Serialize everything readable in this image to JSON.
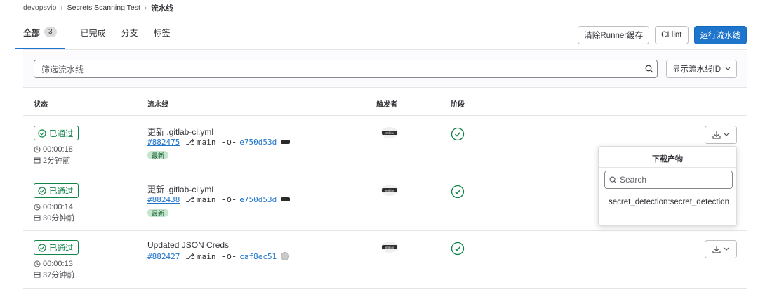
{
  "breadcrumb": {
    "group": "devopsvip",
    "project": "Secrets Scanning Test",
    "current": "流水线"
  },
  "tabs": [
    {
      "label": "全部",
      "count": "3",
      "active": true
    },
    {
      "label": "已完成"
    },
    {
      "label": "分支"
    },
    {
      "label": "标签"
    }
  ],
  "actions": {
    "clear_cache": "清除Runner缓存",
    "ci_lint": "CI lint",
    "run_pipeline": "运行流水线"
  },
  "filter": {
    "placeholder": "筛选流水线",
    "sort_label": "显示流水线ID"
  },
  "columns": {
    "status": "状态",
    "pipeline": "流水线",
    "triggerer": "触发者",
    "stages": "阶段"
  },
  "rows": [
    {
      "status": "已通过",
      "duration": "00:00:18",
      "finished": "2分钟前",
      "title": "更新 .gitlab-ci.yml",
      "id": "#882475",
      "branch": "main",
      "sha": "e750d53d",
      "latest": "最新"
    },
    {
      "status": "已通过",
      "duration": "00:00:14",
      "finished": "30分钟前",
      "title": "更新 .gitlab-ci.yml",
      "id": "#882438",
      "branch": "main",
      "sha": "e750d53d",
      "latest": "最新"
    },
    {
      "status": "已通过",
      "duration": "00:00:13",
      "finished": "37分钟前",
      "title": "Updated JSON Creds",
      "id": "#882427",
      "branch": "main",
      "sha": "caf8ec51"
    }
  ],
  "trigger_avatar_text": "Jenkins",
  "artifacts_dropdown": {
    "title": "下载产物",
    "search_placeholder": "Search",
    "items": [
      "secret_detection:secret_detection"
    ]
  },
  "colors": {
    "primary": "#1f75cb",
    "success": "#108548",
    "latest_bg": "#c3e6cd"
  },
  "icons": [
    "chevron-right-icon",
    "search-icon",
    "chevron-down-icon",
    "check-circle-icon",
    "clock-icon",
    "calendar-icon",
    "branch-icon",
    "commit-icon",
    "download-icon"
  ]
}
